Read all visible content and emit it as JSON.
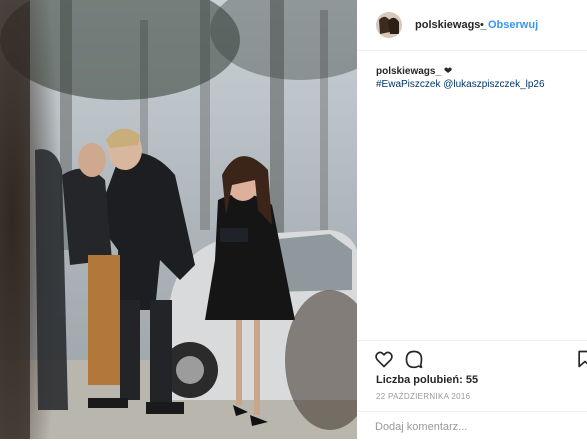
{
  "post": {
    "username": "polskiewags_",
    "dot": "•",
    "follow_label": "Obserwuj",
    "caption_user": "polskiewags_",
    "caption_emoji": "❤",
    "hashtags": [
      "#EwaPiszczek",
      "@lukaszpiszczek_lp26"
    ],
    "likes_text": "Liczba polubień: 55",
    "date": "22 PAŹDZIERNIKA 2016",
    "comment_placeholder": "Dodaj komentarz..."
  },
  "icons": {
    "like": "heart-icon",
    "comment": "speech-bubble-icon",
    "save": "bookmark-icon"
  }
}
